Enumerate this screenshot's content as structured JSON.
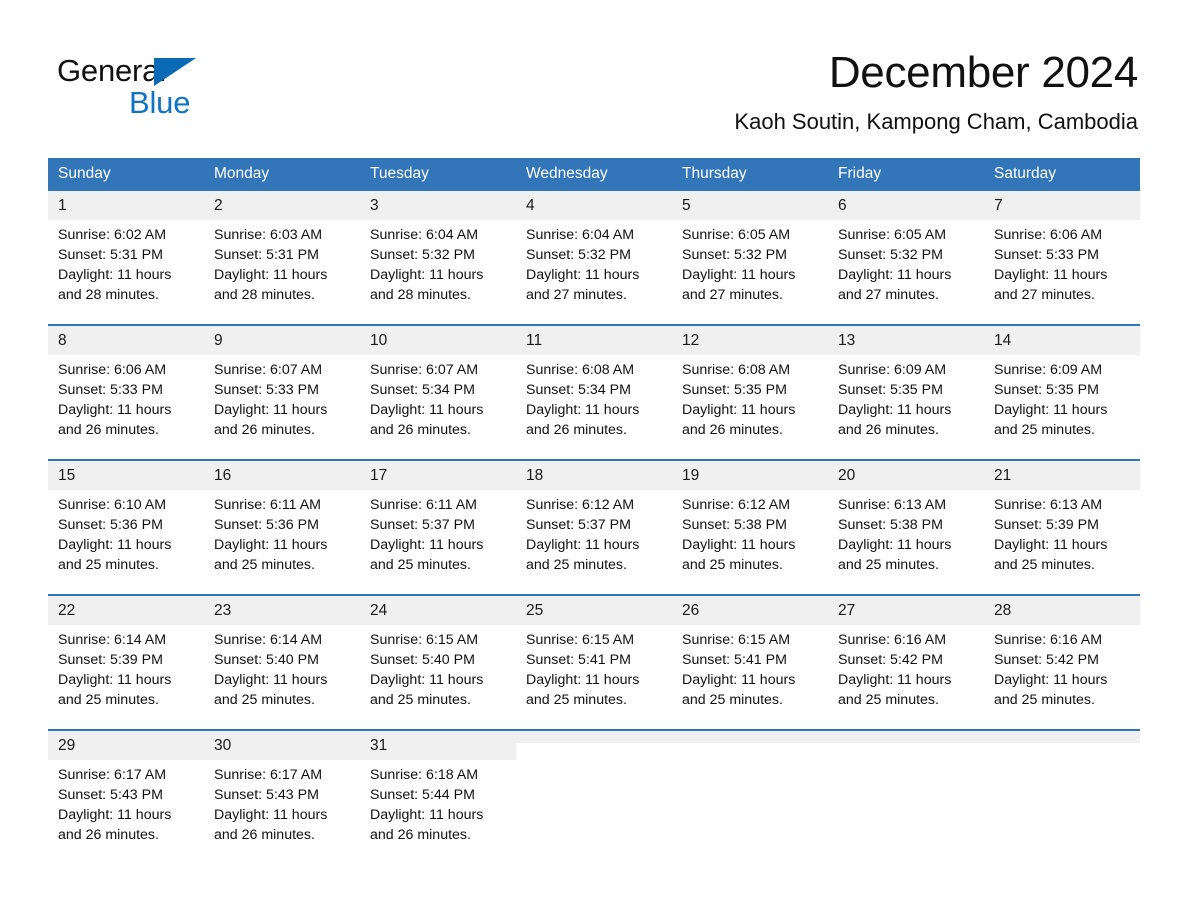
{
  "logo": {
    "word_general": "General",
    "word_blue": "Blue",
    "triangle_color": "#0A6AB5",
    "blue_text_color": "#1272C4"
  },
  "header": {
    "title": "December 2024",
    "location": "Kaoh Soutin, Kampong Cham, Cambodia"
  },
  "theme": {
    "header_blue": "#3275B8",
    "daynum_band": "#F0F0F0",
    "text": "#111111"
  },
  "weekday_headers": [
    "Sunday",
    "Monday",
    "Tuesday",
    "Wednesday",
    "Thursday",
    "Friday",
    "Saturday"
  ],
  "weeks": [
    {
      "days": [
        {
          "day": "1",
          "sunrise": "Sunrise: 6:02 AM",
          "sunset": "Sunset: 5:31 PM",
          "daylight": "Daylight: 11 hours and 28 minutes."
        },
        {
          "day": "2",
          "sunrise": "Sunrise: 6:03 AM",
          "sunset": "Sunset: 5:31 PM",
          "daylight": "Daylight: 11 hours and 28 minutes."
        },
        {
          "day": "3",
          "sunrise": "Sunrise: 6:04 AM",
          "sunset": "Sunset: 5:32 PM",
          "daylight": "Daylight: 11 hours and 28 minutes."
        },
        {
          "day": "4",
          "sunrise": "Sunrise: 6:04 AM",
          "sunset": "Sunset: 5:32 PM",
          "daylight": "Daylight: 11 hours and 27 minutes."
        },
        {
          "day": "5",
          "sunrise": "Sunrise: 6:05 AM",
          "sunset": "Sunset: 5:32 PM",
          "daylight": "Daylight: 11 hours and 27 minutes."
        },
        {
          "day": "6",
          "sunrise": "Sunrise: 6:05 AM",
          "sunset": "Sunset: 5:32 PM",
          "daylight": "Daylight: 11 hours and 27 minutes."
        },
        {
          "day": "7",
          "sunrise": "Sunrise: 6:06 AM",
          "sunset": "Sunset: 5:33 PM",
          "daylight": "Daylight: 11 hours and 27 minutes."
        }
      ]
    },
    {
      "days": [
        {
          "day": "8",
          "sunrise": "Sunrise: 6:06 AM",
          "sunset": "Sunset: 5:33 PM",
          "daylight": "Daylight: 11 hours and 26 minutes."
        },
        {
          "day": "9",
          "sunrise": "Sunrise: 6:07 AM",
          "sunset": "Sunset: 5:33 PM",
          "daylight": "Daylight: 11 hours and 26 minutes."
        },
        {
          "day": "10",
          "sunrise": "Sunrise: 6:07 AM",
          "sunset": "Sunset: 5:34 PM",
          "daylight": "Daylight: 11 hours and 26 minutes."
        },
        {
          "day": "11",
          "sunrise": "Sunrise: 6:08 AM",
          "sunset": "Sunset: 5:34 PM",
          "daylight": "Daylight: 11 hours and 26 minutes."
        },
        {
          "day": "12",
          "sunrise": "Sunrise: 6:08 AM",
          "sunset": "Sunset: 5:35 PM",
          "daylight": "Daylight: 11 hours and 26 minutes."
        },
        {
          "day": "13",
          "sunrise": "Sunrise: 6:09 AM",
          "sunset": "Sunset: 5:35 PM",
          "daylight": "Daylight: 11 hours and 26 minutes."
        },
        {
          "day": "14",
          "sunrise": "Sunrise: 6:09 AM",
          "sunset": "Sunset: 5:35 PM",
          "daylight": "Daylight: 11 hours and 25 minutes."
        }
      ]
    },
    {
      "days": [
        {
          "day": "15",
          "sunrise": "Sunrise: 6:10 AM",
          "sunset": "Sunset: 5:36 PM",
          "daylight": "Daylight: 11 hours and 25 minutes."
        },
        {
          "day": "16",
          "sunrise": "Sunrise: 6:11 AM",
          "sunset": "Sunset: 5:36 PM",
          "daylight": "Daylight: 11 hours and 25 minutes."
        },
        {
          "day": "17",
          "sunrise": "Sunrise: 6:11 AM",
          "sunset": "Sunset: 5:37 PM",
          "daylight": "Daylight: 11 hours and 25 minutes."
        },
        {
          "day": "18",
          "sunrise": "Sunrise: 6:12 AM",
          "sunset": "Sunset: 5:37 PM",
          "daylight": "Daylight: 11 hours and 25 minutes."
        },
        {
          "day": "19",
          "sunrise": "Sunrise: 6:12 AM",
          "sunset": "Sunset: 5:38 PM",
          "daylight": "Daylight: 11 hours and 25 minutes."
        },
        {
          "day": "20",
          "sunrise": "Sunrise: 6:13 AM",
          "sunset": "Sunset: 5:38 PM",
          "daylight": "Daylight: 11 hours and 25 minutes."
        },
        {
          "day": "21",
          "sunrise": "Sunrise: 6:13 AM",
          "sunset": "Sunset: 5:39 PM",
          "daylight": "Daylight: 11 hours and 25 minutes."
        }
      ]
    },
    {
      "days": [
        {
          "day": "22",
          "sunrise": "Sunrise: 6:14 AM",
          "sunset": "Sunset: 5:39 PM",
          "daylight": "Daylight: 11 hours and 25 minutes."
        },
        {
          "day": "23",
          "sunrise": "Sunrise: 6:14 AM",
          "sunset": "Sunset: 5:40 PM",
          "daylight": "Daylight: 11 hours and 25 minutes."
        },
        {
          "day": "24",
          "sunrise": "Sunrise: 6:15 AM",
          "sunset": "Sunset: 5:40 PM",
          "daylight": "Daylight: 11 hours and 25 minutes."
        },
        {
          "day": "25",
          "sunrise": "Sunrise: 6:15 AM",
          "sunset": "Sunset: 5:41 PM",
          "daylight": "Daylight: 11 hours and 25 minutes."
        },
        {
          "day": "26",
          "sunrise": "Sunrise: 6:15 AM",
          "sunset": "Sunset: 5:41 PM",
          "daylight": "Daylight: 11 hours and 25 minutes."
        },
        {
          "day": "27",
          "sunrise": "Sunrise: 6:16 AM",
          "sunset": "Sunset: 5:42 PM",
          "daylight": "Daylight: 11 hours and 25 minutes."
        },
        {
          "day": "28",
          "sunrise": "Sunrise: 6:16 AM",
          "sunset": "Sunset: 5:42 PM",
          "daylight": "Daylight: 11 hours and 25 minutes."
        }
      ]
    },
    {
      "days": [
        {
          "day": "29",
          "sunrise": "Sunrise: 6:17 AM",
          "sunset": "Sunset: 5:43 PM",
          "daylight": "Daylight: 11 hours and 26 minutes."
        },
        {
          "day": "30",
          "sunrise": "Sunrise: 6:17 AM",
          "sunset": "Sunset: 5:43 PM",
          "daylight": "Daylight: 11 hours and 26 minutes."
        },
        {
          "day": "31",
          "sunrise": "Sunrise: 6:18 AM",
          "sunset": "Sunset: 5:44 PM",
          "daylight": "Daylight: 11 hours and 26 minutes."
        },
        {
          "day": "",
          "sunrise": "",
          "sunset": "",
          "daylight": ""
        },
        {
          "day": "",
          "sunrise": "",
          "sunset": "",
          "daylight": ""
        },
        {
          "day": "",
          "sunrise": "",
          "sunset": "",
          "daylight": ""
        },
        {
          "day": "",
          "sunrise": "",
          "sunset": "",
          "daylight": ""
        }
      ]
    }
  ]
}
